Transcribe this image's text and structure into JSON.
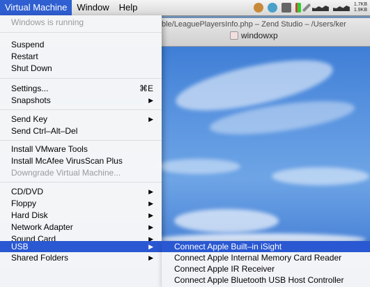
{
  "menubar": {
    "items": [
      "Virtual Machine",
      "Window",
      "Help"
    ],
    "active_index": 0,
    "net_speed": [
      "1.7KB",
      "1.9KB"
    ]
  },
  "window": {
    "path": "ble/LeaguePlayersInfo.php – Zend Studio – /Users/ker",
    "title": "windowxp"
  },
  "menu": {
    "status": "Windows is running",
    "group1": [
      "Suspend",
      "Restart",
      "Shut Down"
    ],
    "settings": {
      "label": "Settings...",
      "shortcut": "⌘E"
    },
    "snapshots": "Snapshots",
    "send_key": "Send Key",
    "send_cad": "Send Ctrl–Alt–Del",
    "install_vmware": "Install VMware Tools",
    "install_mcafee": "Install McAfee VirusScan Plus",
    "downgrade": "Downgrade Virtual Machine...",
    "devices": [
      "CD/DVD",
      "Floppy",
      "Hard Disk",
      "Network Adapter",
      "Sound Card",
      "USB"
    ],
    "shared_folders": "Shared Folders",
    "highlighted": "USB"
  },
  "submenu": {
    "items": [
      "Connect Apple Built–in iSight",
      "Connect Apple Internal Memory Card Reader",
      "Connect Apple IR Receiver",
      "Connect Apple Bluetooth USB Host Controller"
    ],
    "highlighted_index": 0
  },
  "colors": {
    "highlight": "#2a58d2",
    "menubar_active": "#2f5fd0"
  },
  "icons": [
    "recording-icon",
    "network-icon",
    "display-icon",
    "battery-icon",
    "edit-icon",
    "bandwidth-graph-icon"
  ]
}
